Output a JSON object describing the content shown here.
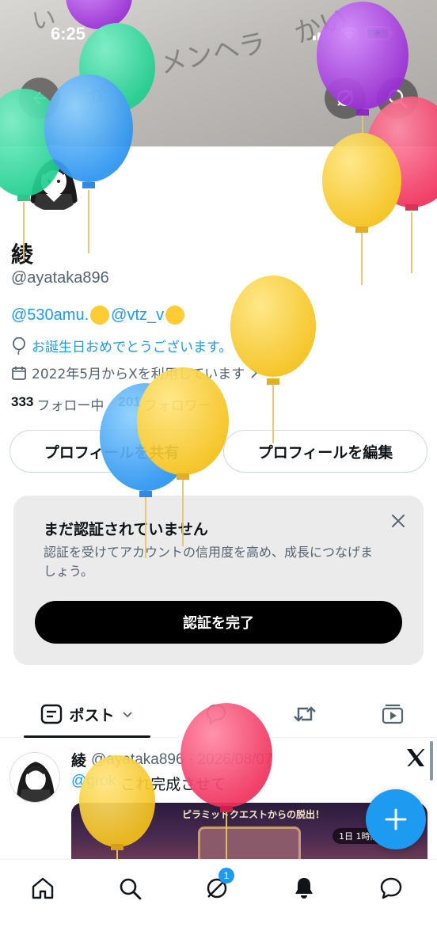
{
  "status_bar": {
    "time": "6:25"
  },
  "profile": {
    "name": "綾",
    "handle": "@ayataka896",
    "bio_mention_1": "@530amu.",
    "bio_mention_2": "@vtz_v",
    "birthday_text": "お誕生日おめでとうございます。",
    "joined_text": "2022年5月からXを利用しています",
    "following_count": "333",
    "following_label": "フォロー中",
    "followers_count": "201",
    "followers_label": "フォロワー",
    "share_button": "プロフィールを共有",
    "edit_button": "プロフィールを編集"
  },
  "verification": {
    "title": "まだ認証されていません",
    "description": "認証を受けてアカウントの信用度を高め、成長につなげましょう。",
    "button": "認証を完了"
  },
  "tabs": {
    "posts_label": "ポスト"
  },
  "post": {
    "author": "綾",
    "handle_date": "@ayataka896 · 2026/08/07",
    "mention": "@grok",
    "text": "これ完成させて",
    "image_banner": "ピラミッドクエストからの脱出！",
    "image_timer": "1日 1時間"
  },
  "nav": {
    "notification_badge": "1"
  },
  "colors": {
    "accent": "#1d9bf0",
    "text": "#0f1419",
    "muted": "#536471"
  }
}
